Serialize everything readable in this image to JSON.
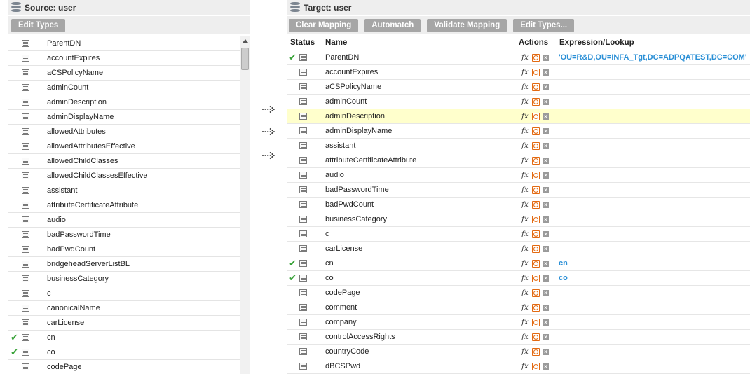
{
  "source": {
    "title": "Source: user",
    "edit_types_label": "Edit Types",
    "rows": [
      {
        "name": "ParentDN",
        "mapped": false
      },
      {
        "name": "accountExpires",
        "mapped": false
      },
      {
        "name": "aCSPolicyName",
        "mapped": false
      },
      {
        "name": "adminCount",
        "mapped": false
      },
      {
        "name": "adminDescription",
        "mapped": false
      },
      {
        "name": "adminDisplayName",
        "mapped": false
      },
      {
        "name": "allowedAttributes",
        "mapped": false
      },
      {
        "name": "allowedAttributesEffective",
        "mapped": false
      },
      {
        "name": "allowedChildClasses",
        "mapped": false
      },
      {
        "name": "allowedChildClassesEffective",
        "mapped": false
      },
      {
        "name": "assistant",
        "mapped": false
      },
      {
        "name": "attributeCertificateAttribute",
        "mapped": false
      },
      {
        "name": "audio",
        "mapped": false
      },
      {
        "name": "badPasswordTime",
        "mapped": false
      },
      {
        "name": "badPwdCount",
        "mapped": false
      },
      {
        "name": "bridgeheadServerListBL",
        "mapped": false
      },
      {
        "name": "businessCategory",
        "mapped": false
      },
      {
        "name": "c",
        "mapped": false
      },
      {
        "name": "canonicalName",
        "mapped": false
      },
      {
        "name": "carLicense",
        "mapped": false
      },
      {
        "name": "cn",
        "mapped": true
      },
      {
        "name": "co",
        "mapped": true
      },
      {
        "name": "codePage",
        "mapped": false
      }
    ]
  },
  "target": {
    "title": "Target: user",
    "buttons": {
      "clear": "Clear Mapping",
      "automatch": "Automatch",
      "validate": "Validate Mapping",
      "edit_types": "Edit Types..."
    },
    "columns": {
      "status": "Status",
      "name": "Name",
      "actions": "Actions",
      "expression": "Expression/Lookup"
    },
    "rows": [
      {
        "name": "ParentDN",
        "mapped": true,
        "expression": "'OU=R&D,OU=INFA_Tgt,DC=ADPQATEST,DC=COM'"
      },
      {
        "name": "accountExpires",
        "mapped": false,
        "expression": ""
      },
      {
        "name": "aCSPolicyName",
        "mapped": false,
        "expression": ""
      },
      {
        "name": "adminCount",
        "mapped": false,
        "expression": ""
      },
      {
        "name": "adminDescription",
        "mapped": false,
        "expression": "",
        "highlight": true
      },
      {
        "name": "adminDisplayName",
        "mapped": false,
        "expression": ""
      },
      {
        "name": "assistant",
        "mapped": false,
        "expression": ""
      },
      {
        "name": "attributeCertificateAttribute",
        "mapped": false,
        "expression": ""
      },
      {
        "name": "audio",
        "mapped": false,
        "expression": ""
      },
      {
        "name": "badPasswordTime",
        "mapped": false,
        "expression": ""
      },
      {
        "name": "badPwdCount",
        "mapped": false,
        "expression": ""
      },
      {
        "name": "businessCategory",
        "mapped": false,
        "expression": ""
      },
      {
        "name": "c",
        "mapped": false,
        "expression": ""
      },
      {
        "name": "carLicense",
        "mapped": false,
        "expression": ""
      },
      {
        "name": "cn",
        "mapped": true,
        "expression": "cn"
      },
      {
        "name": "co",
        "mapped": true,
        "expression": "co"
      },
      {
        "name": "codePage",
        "mapped": false,
        "expression": ""
      },
      {
        "name": "comment",
        "mapped": false,
        "expression": ""
      },
      {
        "name": "company",
        "mapped": false,
        "expression": ""
      },
      {
        "name": "controlAccessRights",
        "mapped": false,
        "expression": ""
      },
      {
        "name": "countryCode",
        "mapped": false,
        "expression": ""
      },
      {
        "name": "dBCSPwd",
        "mapped": false,
        "expression": ""
      }
    ]
  },
  "icons": {
    "status_mapped": "checkmark-icon",
    "field": "field-icon",
    "expression": "fx-icon",
    "lookup": "lookup-icon",
    "delete": "delete-icon",
    "database": "database-icon",
    "map_arrow": "map-arrow-icon"
  },
  "colors": {
    "button_bg": "#a6a6a6",
    "header_bg": "#eeeeee",
    "expression_text": "#2a8fd6",
    "highlight_row": "#ffffcc",
    "check_green": "#3aa33a",
    "lookup_orange": "#e36a12"
  }
}
